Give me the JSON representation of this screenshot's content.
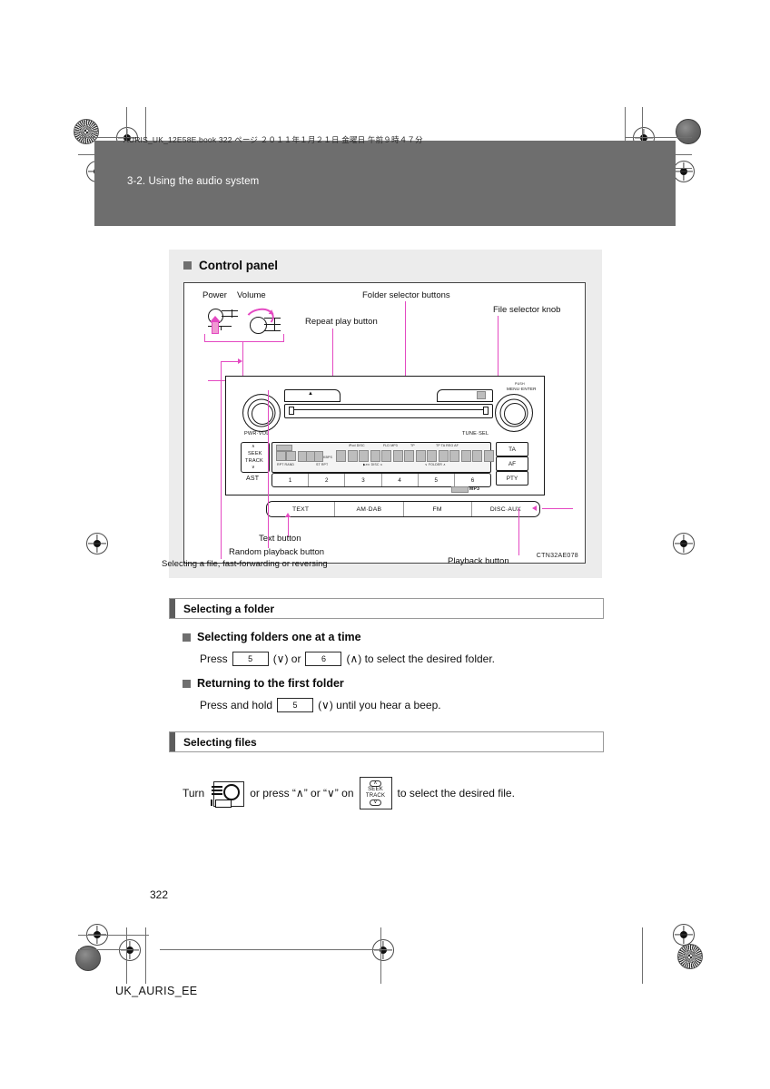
{
  "document": {
    "print_header": "AURIS_UK_12E58E.book   322 ページ   ２０１１年１月２１日   金曜日   午前９時４７分",
    "running_head": "3-2. Using the audio system",
    "page_number": "322",
    "footer_code": "UK_AURIS_EE"
  },
  "control_panel": {
    "heading": "Control panel",
    "figure_id": "CTN32AE078",
    "callouts": {
      "power": "Power",
      "volume": "Volume",
      "folder_selector": "Folder selector buttons",
      "repeat_play": "Repeat play button",
      "file_selector_knob": "File selector knob",
      "text_button": "Text button",
      "random_playback": "Random playback button",
      "selecting_file": "Selecting a file, fast-forwarding or reversing",
      "playback_button": "Playback button"
    },
    "unit": {
      "left_knob_label": "PWR·VOL",
      "right_knob_label": "TUNE·SEL",
      "push_label": "PUSH",
      "menu_enter_label": "MENU·ENTER",
      "eject_symbol": "▲",
      "seek_label_top": "SEEK",
      "seek_label_bottom": "TRACK",
      "seek_up": "∧",
      "seek_down": "∨",
      "ast_label": "AST",
      "presets": [
        "1",
        "2",
        "3",
        "4",
        "5",
        "6"
      ],
      "side_buttons": [
        "TA",
        "AF",
        "PTY"
      ],
      "mode_buttons": [
        "TEXT",
        "AM·DAB",
        "FM",
        "DISC·AUX"
      ],
      "mp3_logo": "MP3",
      "lcd": {
        "top_indicators": [
          "iPod",
          "DISC",
          "FLD",
          "MP3",
          "TP",
          "TP TA",
          "REG AF"
        ],
        "bottom_indicators": [
          "RPT",
          "RAND",
          "ST",
          "DISC",
          "FOLDER"
        ],
        "digits": "888",
        "kbps_label": "KBPS"
      }
    }
  },
  "sections": [
    {
      "title": "Selecting a folder",
      "subsections": [
        {
          "heading": "Selecting folders one at a time",
          "line_parts": [
            "Press ",
            "5",
            " (∨) or ",
            "6",
            " (∧) to select the desired folder."
          ]
        },
        {
          "heading": "Returning to the first folder",
          "line_parts": [
            "Press and hold ",
            "5",
            " (∨) until you hear a beep."
          ]
        }
      ]
    },
    {
      "title": "Selecting files",
      "instruction": {
        "prefix": "Turn",
        "middle": "or press “∧” or “∨” on",
        "suffix": "to select the desired file.",
        "seek_button": {
          "up": "∧",
          "label_top": "SEEK",
          "label_bottom": "TRACK",
          "down": "∨"
        }
      }
    }
  ],
  "colors": {
    "header_bar": "#6e6e6e",
    "panel_bg": "#ececec",
    "callout": "#e449c2",
    "section_bar": "#5d5d5d"
  }
}
